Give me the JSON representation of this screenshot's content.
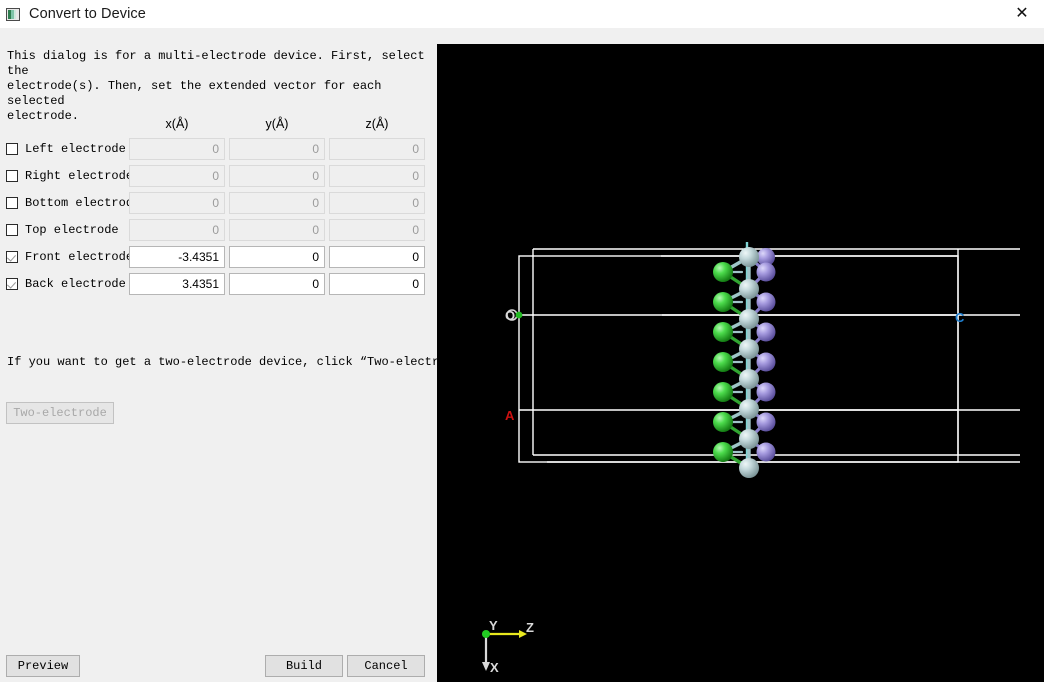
{
  "window": {
    "title": "Convert to Device",
    "icon": "app-icon",
    "close_label": "✕"
  },
  "dialog": {
    "description": "This dialog is for a multi-electrode device. First, select the\nelectrode(s). Then, set the extended vector for each selected\nelectrode.",
    "two_electrode_hint": "If you want to get a two-electrode device, click “Two-electrode”",
    "two_electrode_button": "Two-electrode",
    "two_electrode_button_enabled": false
  },
  "table": {
    "headers": [
      "x(Å)",
      "y(Å)",
      "z(Å)"
    ],
    "rows": [
      {
        "label": "Left electrode",
        "checked": false,
        "enabled": false,
        "x": "0",
        "y": "0",
        "z": "0"
      },
      {
        "label": "Right electrode",
        "checked": false,
        "enabled": false,
        "x": "0",
        "y": "0",
        "z": "0"
      },
      {
        "label": "Bottom electrode",
        "checked": false,
        "enabled": false,
        "x": "0",
        "y": "0",
        "z": "0"
      },
      {
        "label": "Top electrode",
        "checked": false,
        "enabled": false,
        "x": "0",
        "y": "0",
        "z": "0"
      },
      {
        "label": "Front electrode",
        "checked": true,
        "enabled": true,
        "x": "-3.4351",
        "y": "0",
        "z": "0"
      },
      {
        "label": "Back electrode",
        "checked": true,
        "enabled": true,
        "x": "3.4351",
        "y": "0",
        "z": "0"
      }
    ]
  },
  "footer": {
    "preview": "Preview",
    "build": "Build",
    "cancel": "Cancel"
  },
  "viewer": {
    "background": "#000000",
    "cell_labels": {
      "origin": "O",
      "a": "A",
      "c": "C"
    },
    "label_colors": {
      "origin": "#d8d8d8",
      "a": "#cc1111",
      "c": "#1f7fd0"
    },
    "gizmo": {
      "x": "X",
      "y": "Y",
      "z": "Z"
    },
    "gizmo_colors": {
      "x": "#d9d9d9",
      "y": "#22cc22",
      "z": "#e8e81e"
    },
    "atom_colors": {
      "green": "#31c231",
      "silver": "#b9cfd2",
      "purple": "#9f96d8"
    },
    "cell_color": "#ffffff"
  }
}
